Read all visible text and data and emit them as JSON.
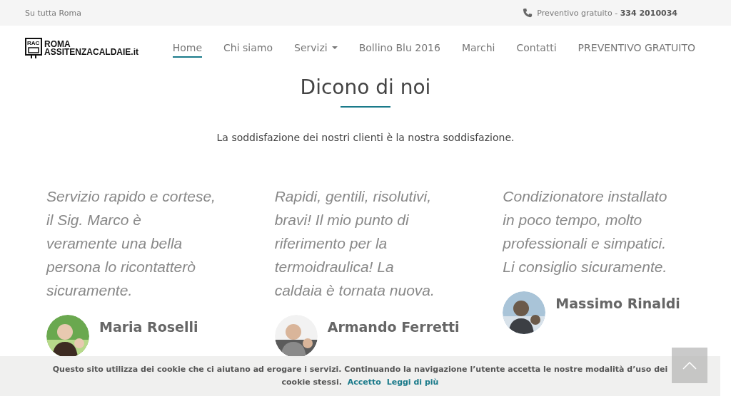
{
  "top_bar": {
    "area": "Su tutta Roma",
    "phone": "Preventivo gratuito - **334 2010034**"
  },
  "logo": {
    "badge": "RAC",
    "line1": "ROMA",
    "line2": "ASSITENZACALDAIE.it"
  },
  "nav": [
    {
      "label": "Home",
      "selected": true,
      "caret": false
    },
    {
      "label": "Chi siamo",
      "selected": false,
      "caret": false
    },
    {
      "label": "Servizi",
      "selected": false,
      "caret": true
    },
    {
      "label": "Bollino Blu 2016",
      "selected": false,
      "caret": false
    },
    {
      "label": "Marchi",
      "selected": false,
      "caret": false
    },
    {
      "label": "Contatti",
      "selected": false,
      "caret": false
    },
    {
      "label": "PREVENTIVO GRATUITO",
      "selected": false,
      "caret": false
    }
  ],
  "section": {
    "title": "Dicono di noi",
    "subtitle": "La soddisfazione dei nostri clienti è la nostra soddisfazione."
  },
  "testimonials": [
    {
      "quote": "Servizio rapido e cortese, il Sig. Marco è veramente una bella persona lo ricontatterò sicuramente.",
      "name": "Maria Roselli"
    },
    {
      "quote": "Rapidi, gentili, risolutivi, bravi! Il mio punto di riferimento per la termoidraulica! La caldaia è tornata nuova.",
      "name": "Armando Ferretti"
    },
    {
      "quote": "Condizionatore installato in poco tempo, molto professionali e simpatici. Li consiglio sicuramente.",
      "name": "Massimo Rinaldi"
    }
  ],
  "cookie_bar": {
    "text": "Questo sito utilizza dei cookie che ci aiutano ad erogare i servizi. Continuando la navigazione l’utente accetta le nostre modalità d’uso dei cookie stessi.",
    "links": [
      "Accetto",
      "Leggi di più"
    ]
  }
}
